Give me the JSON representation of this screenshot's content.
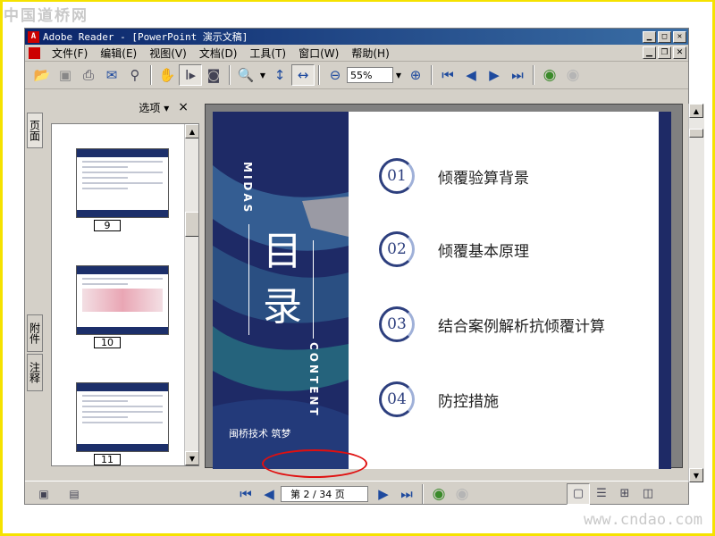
{
  "watermarks": {
    "top": "中国道桥网",
    "bottom": "www.cndao.com"
  },
  "window": {
    "title": "Adobe Reader - [PowerPoint 演示文稿]",
    "app_icon": "adobe-reader-icon"
  },
  "menu": [
    "文件(F)",
    "编辑(E)",
    "视图(V)",
    "文档(D)",
    "工具(T)",
    "窗口(W)",
    "帮助(H)"
  ],
  "toolbar": {
    "zoom_value": "55%"
  },
  "side_tabs": {
    "pages": "页面",
    "attachments": "附件",
    "comments": "注释"
  },
  "thumb_panel": {
    "options_label": "选项 ▾",
    "close_label": "×",
    "thumbs": [
      "9",
      "10",
      "11"
    ]
  },
  "slide": {
    "left_top_text": "MIDAS",
    "title": "目录",
    "left_bottom_text": "CONTENT",
    "logo_text": "闽桥技术 筑梦",
    "items": [
      {
        "num": "01",
        "text": "倾覆验算背景"
      },
      {
        "num": "02",
        "text": "倾覆基本原理"
      },
      {
        "num": "03",
        "text": "结合案例解析抗倾覆计算"
      },
      {
        "num": "04",
        "text": "防控措施"
      }
    ]
  },
  "statusbar": {
    "page_label": "第 2 / 34 页"
  },
  "colors": {
    "title_bar": "#0a246a",
    "slide_navy": "#1e2a66",
    "highlight_circle": "#e01010"
  }
}
